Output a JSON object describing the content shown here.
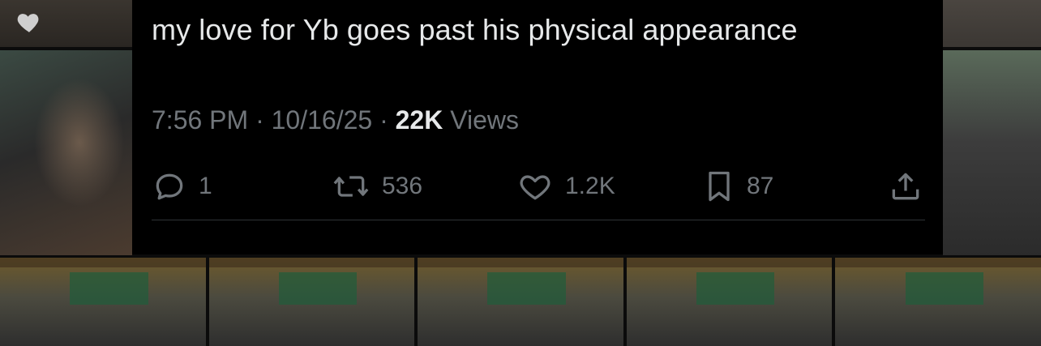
{
  "tweet": {
    "text": "my love for Yb goes past his physical appearance",
    "time": "7:56 PM",
    "separator_1": "·",
    "date": "10/16/25",
    "separator_2": "·",
    "views_count": "22K",
    "views_label": "Views"
  },
  "actions": {
    "replies": "1",
    "reposts": "536",
    "likes": "1.2K",
    "bookmarks": "87"
  },
  "icons": {
    "overlay_like": "heart-icon",
    "reply": "reply-icon",
    "repost": "repost-icon",
    "like": "like-icon",
    "bookmark": "bookmark-icon",
    "share": "share-icon"
  },
  "colors": {
    "card_bg": "#000000",
    "text_primary": "#e7e9ea",
    "text_secondary": "#71767b",
    "divider": "#2f3336"
  }
}
